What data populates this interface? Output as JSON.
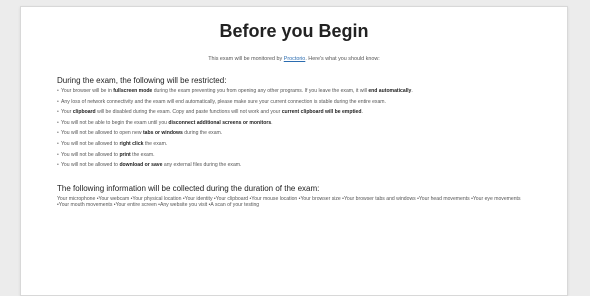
{
  "page": {
    "title": "Before you Begin",
    "intro": {
      "before_link": "This exam will be monitored by ",
      "link": "Proctorio",
      "after_link": ". Here's what you should know:"
    }
  },
  "restrictions": {
    "heading": "During the exam, the following will be restricted:",
    "items": [
      {
        "a": "Your browser will be in ",
        "b": "fullscreen mode",
        "c": " during the exam preventing you from opening any other programs. If you leave the exam, it will ",
        "d": "end automatically",
        "e": "."
      },
      {
        "a": "Any loss of network connectivity and the exam will end automatically, please make sure your current connection is stable during the entire exam.",
        "b": "",
        "c": "",
        "d": "",
        "e": ""
      },
      {
        "a": "Your ",
        "b": "clipboard",
        "c": " will be disabled during the exam. Copy and paste functions will not work and your ",
        "d": "current clipboard will be emptied",
        "e": "."
      },
      {
        "a": "You will not be able to begin the exam until you ",
        "b": "disconnect additional screens or monitors",
        "c": ".",
        "d": "",
        "e": ""
      },
      {
        "a": "You will not be allowed to open new ",
        "b": "tabs or windows",
        "c": " during the exam.",
        "d": "",
        "e": ""
      },
      {
        "a": "You will not be allowed to ",
        "b": "right click",
        "c": " the exam.",
        "d": "",
        "e": ""
      },
      {
        "a": "You will not be allowed to ",
        "b": "print",
        "c": " the exam.",
        "d": "",
        "e": ""
      },
      {
        "a": "You will not be allowed to ",
        "b": "download or save",
        "c": " any external files during the exam.",
        "d": "",
        "e": ""
      }
    ]
  },
  "collection": {
    "heading": "The following information will be collected during the duration of the exam:",
    "text": "Your microphone •Your webcam •Your physical location •Your identity •Your clipboard •Your mouse location •Your browser size •Your browser tabs and windows •Your head movements •Your eye movements •Your mouth movements •Your entire screen •Any website you visit •A scan of your testing"
  }
}
